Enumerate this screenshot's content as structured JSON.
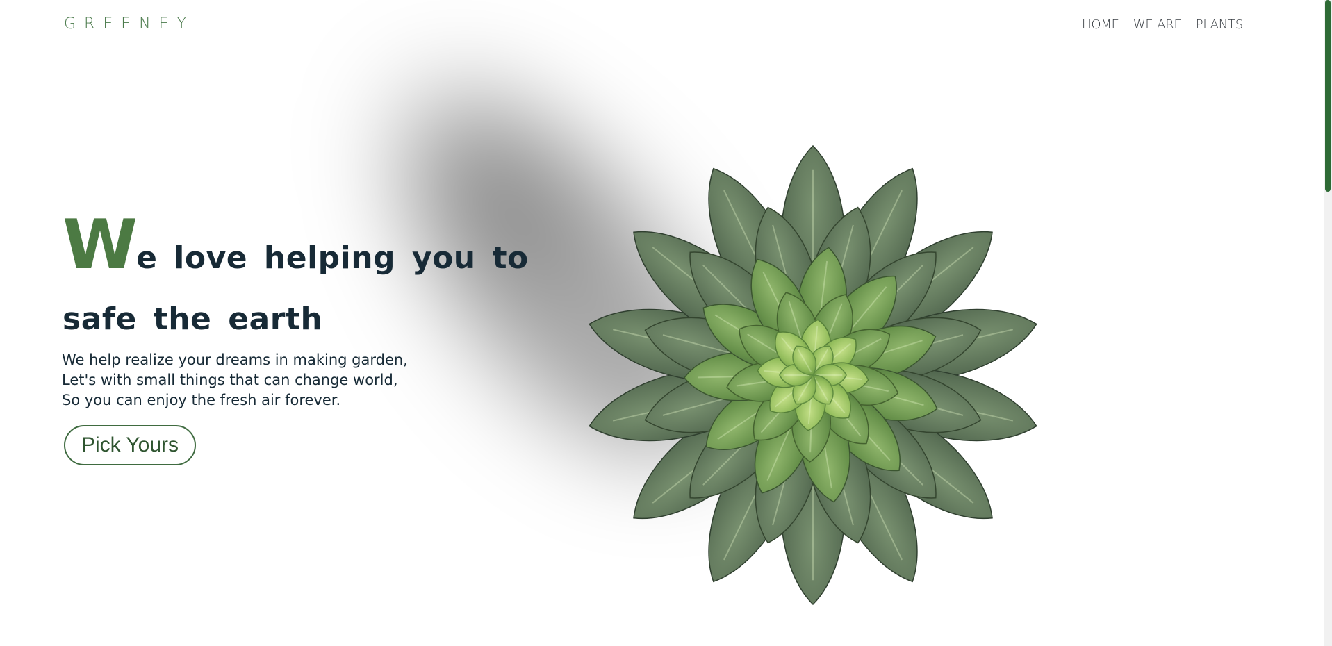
{
  "brand": {
    "logo": "GREENEY"
  },
  "nav": {
    "items": [
      "HOME",
      "WE ARE",
      "PLANTS"
    ]
  },
  "hero": {
    "title_initial": "W",
    "title_rest": "e love helping you to",
    "title_line2": "safe the earth",
    "description": [
      "We help realize your dreams in making garden,",
      "Let's with small things that can change world,",
      "So you can enjoy the fresh air forever."
    ],
    "cta_label": "Pick Yours"
  },
  "illustration": {
    "icon": "succulent-plant-icon"
  },
  "colors": {
    "accent": "#4c7a43",
    "heading": "#172a36",
    "logo": "#4a7a4b",
    "scroll_thumb": "#2e6a35",
    "background": "#ffffff"
  }
}
